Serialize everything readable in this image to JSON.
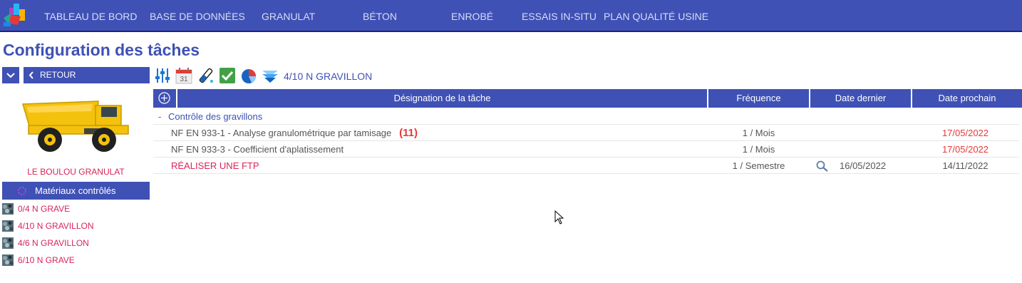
{
  "nav": {
    "items": [
      "TABLEAU DE BORD",
      "BASE DE DONNÉES",
      "GRANULAT",
      "BÉTON",
      "ENROBÉ",
      "ESSAIS IN-SITU",
      "PLAN QUALITÉ USINE"
    ]
  },
  "page": {
    "title": "Configuration des tâches"
  },
  "sidebar": {
    "back_label": "RETOUR",
    "site_name": "LE BOULOU GRANULAT",
    "materials_header": "Matériaux contrôlés",
    "materials": [
      "0/4 N GRAVE",
      "4/10 N GRAVILLON",
      "4/6 N GRAVILLON",
      "6/10 N GRAVE"
    ]
  },
  "toolbar": {
    "calendar_day": "31",
    "material_title": "4/10 N GRAVILLON"
  },
  "table": {
    "headers": {
      "designation": "Désignation de la tâche",
      "frequency": "Fréquence",
      "last_date": "Date dernier",
      "next_date": "Date prochain"
    },
    "group": {
      "toggle": "-",
      "label": "Contrôle des gravillons"
    },
    "rows": [
      {
        "name": "NF EN 933-1 - Analyse granulométrique par tamisage",
        "count": "(11)",
        "frequency": "1 / Mois",
        "last": "",
        "next": "17/05/2022",
        "overdue": true
      },
      {
        "name": "NF EN 933-3 - Coefficient d'aplatissement",
        "count": "",
        "frequency": "1 / Mois",
        "last": "",
        "next": "17/05/2022",
        "overdue": true
      },
      {
        "name": "RÉALISER UNE FTP",
        "count": "",
        "frequency": "1 / Semestre",
        "last": "16/05/2022",
        "next": "14/11/2022",
        "overdue": false
      }
    ]
  },
  "colors": {
    "primary": "#3f51b5",
    "accent_pink": "#d8245a",
    "overdue_red": "#e53935"
  }
}
